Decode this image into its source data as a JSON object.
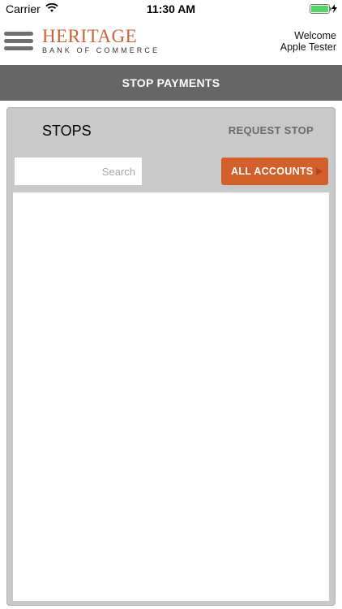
{
  "status_bar": {
    "carrier": "Carrier",
    "time": "11:30 AM",
    "battery_level": 1.0
  },
  "header": {
    "logo_main": "HERITAGE",
    "logo_sub": "BANK OF COMMERCE",
    "welcome_line1": "Welcome",
    "welcome_line2": "Apple Tester"
  },
  "page": {
    "title": "STOP PAYMENTS"
  },
  "stops": {
    "title": "STOPS",
    "request_label": "REQUEST STOP",
    "search_placeholder": "Search",
    "accounts_label": "ALL ACCOUNTS"
  },
  "colors": {
    "brand": "#c8633a",
    "accent_button": "#d3602b",
    "title_bar": "#666666",
    "panel": "#c9c9c9"
  }
}
